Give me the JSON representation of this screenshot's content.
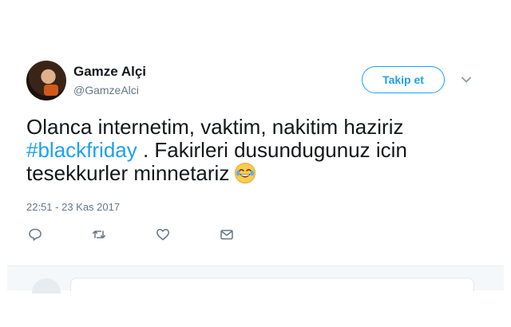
{
  "user": {
    "name": "Gamze Alçi",
    "handle": "@GamzeAlci",
    "avatar_icon": "profile-photo"
  },
  "follow_button": {
    "label": "Takip et"
  },
  "menu_icon": "chevron-down-icon",
  "tweet": {
    "line1": "Olanca internetim, vaktim, nakitim haziriz",
    "hashtag": "#blackfriday",
    "line2_rest": " . Fakirleri dusundugunuz icin",
    "line3": "tesekkurler minnetariz",
    "emoji": "face-with-tears-of-joy"
  },
  "timestamp": "22:51 - 23 Kas 2017",
  "actions": [
    "reply-icon",
    "retweet-icon",
    "like-icon",
    "direct-message-icon"
  ],
  "colors": {
    "accent": "#1da1f2",
    "text": "#14171a",
    "secondary": "#657786",
    "reply_bg": "#f5f8fa"
  }
}
